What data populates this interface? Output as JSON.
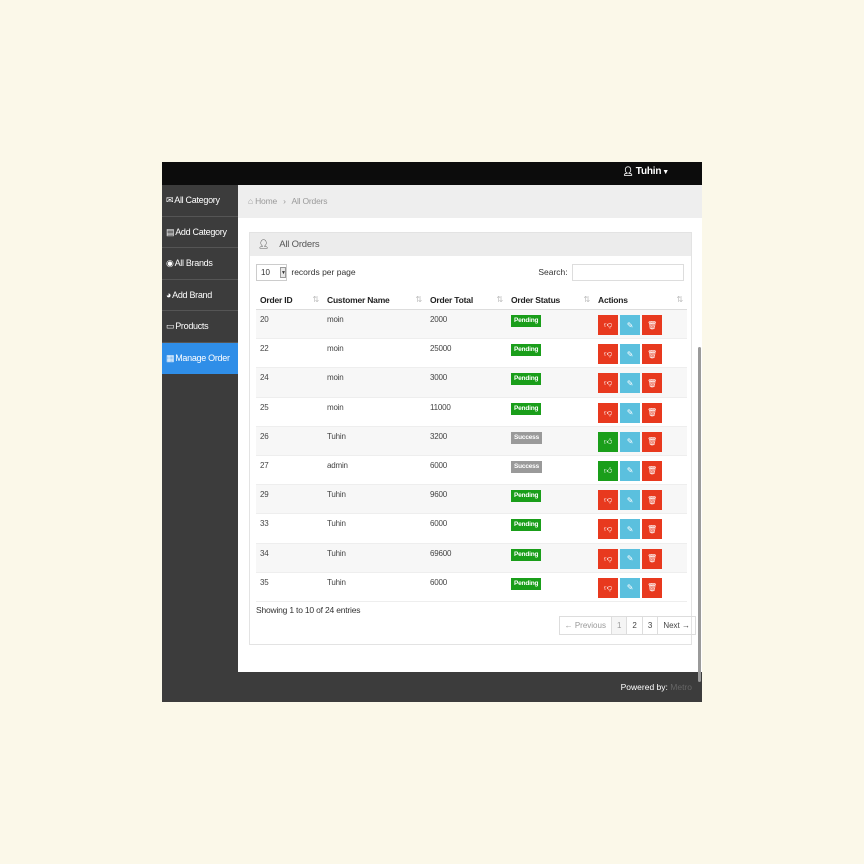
{
  "header": {
    "user_name": "Tuhin",
    "user_icon": "user-icon"
  },
  "sidebar": {
    "items": [
      {
        "label": "All Category",
        "icon": "envelope-icon",
        "active": false
      },
      {
        "label": "Add Category",
        "icon": "list-icon",
        "active": false
      },
      {
        "label": "All Brands",
        "icon": "eye-icon",
        "active": false
      },
      {
        "label": "Add Brand",
        "icon": "dashboard-icon",
        "active": false
      },
      {
        "label": "Products",
        "icon": "folder-icon",
        "active": false
      },
      {
        "label": "Manage Order",
        "icon": "table-icon",
        "active": true
      }
    ]
  },
  "breadcrumb": {
    "home": "Home",
    "current": "All Orders"
  },
  "panel": {
    "title": "All Orders"
  },
  "table_controls": {
    "length_value": "10",
    "length_label": "records per page",
    "search_label": "Search:",
    "search_value": ""
  },
  "table": {
    "columns": [
      "Order ID",
      "Customer Name",
      "Order Total",
      "Order Status",
      "Actions"
    ],
    "rows": [
      {
        "id": "20",
        "customer": "moin",
        "total": "2000",
        "status": "Pending"
      },
      {
        "id": "22",
        "customer": "moin",
        "total": "25000",
        "status": "Pending"
      },
      {
        "id": "24",
        "customer": "moin",
        "total": "3000",
        "status": "Pending"
      },
      {
        "id": "25",
        "customer": "moin",
        "total": "11000",
        "status": "Pending"
      },
      {
        "id": "26",
        "customer": "Tuhin",
        "total": "3200",
        "status": "Success"
      },
      {
        "id": "27",
        "customer": "admin",
        "total": "6000",
        "status": "Success"
      },
      {
        "id": "29",
        "customer": "Tuhin",
        "total": "9600",
        "status": "Pending"
      },
      {
        "id": "33",
        "customer": "Tuhin",
        "total": "6000",
        "status": "Pending"
      },
      {
        "id": "34",
        "customer": "Tuhin",
        "total": "69600",
        "status": "Pending"
      },
      {
        "id": "35",
        "customer": "Tuhin",
        "total": "6000",
        "status": "Pending"
      }
    ]
  },
  "info": "Showing 1 to 10 of 24 entries",
  "pagination": {
    "prev": "← Previous",
    "pages": [
      "1",
      "2",
      "3"
    ],
    "next": "Next →",
    "current": "1"
  },
  "footer": {
    "label": "Powered by:",
    "brand": "Metro"
  },
  "colors": {
    "pending": "#1a9e1a",
    "success": "#9a9a9a",
    "red_button": "#e8391e",
    "green_button": "#1a9e1a",
    "blue_button": "#5bc0de",
    "sidebar_active": "#2f8ee8"
  }
}
